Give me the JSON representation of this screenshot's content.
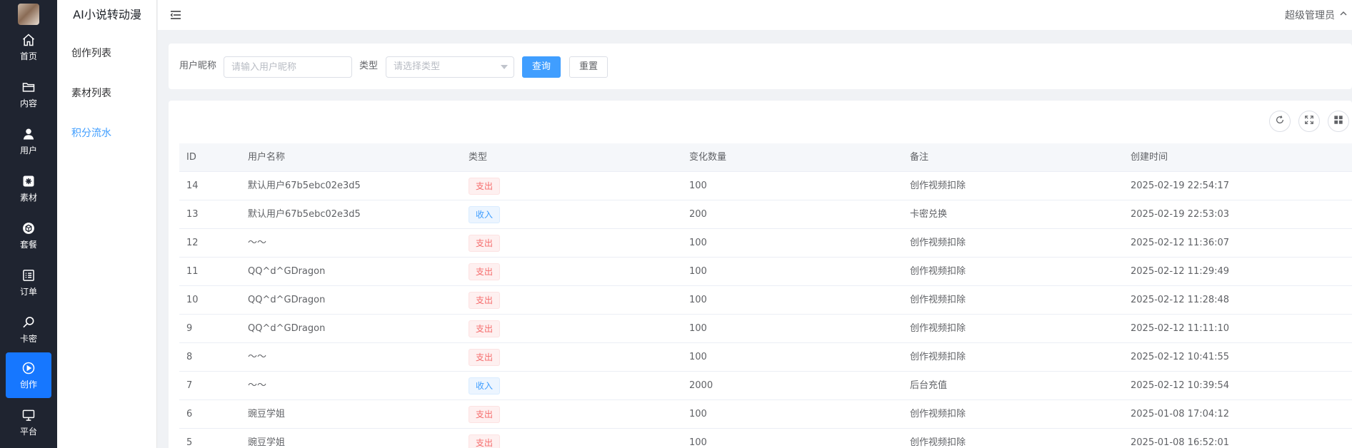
{
  "app": {
    "title": "AI小说转动漫"
  },
  "rail": {
    "items": [
      {
        "label": "首页",
        "icon": "home-icon"
      },
      {
        "label": "内容",
        "icon": "folder-icon"
      },
      {
        "label": "用户",
        "icon": "user-icon"
      },
      {
        "label": "素材",
        "icon": "material-icon"
      },
      {
        "label": "套餐",
        "icon": "package-icon"
      },
      {
        "label": "订单",
        "icon": "order-list-icon"
      },
      {
        "label": "卡密",
        "icon": "search-key-icon"
      },
      {
        "label": "创作",
        "icon": "play-circle-icon",
        "active": true
      },
      {
        "label": "平台",
        "icon": "monitor-icon"
      }
    ]
  },
  "submenu": {
    "items": [
      {
        "label": "创作列表"
      },
      {
        "label": "素材列表"
      },
      {
        "label": "积分流水",
        "active": true
      }
    ]
  },
  "header": {
    "user": "超级管理员"
  },
  "search": {
    "nickname_label": "用户昵称",
    "nickname_placeholder": "请输入用户昵称",
    "type_label": "类型",
    "type_placeholder": "请选择类型",
    "query_button": "查询",
    "reset_button": "重置"
  },
  "table": {
    "columns": [
      "ID",
      "用户名称",
      "类型",
      "变化数量",
      "备注",
      "创建时间"
    ],
    "rows": [
      {
        "id": "14",
        "name": "默认用户67b5ebc02e3d5",
        "type": "支出",
        "kind": "out",
        "amount": "100",
        "note": "创作视频扣除",
        "time": "2025-02-19 22:54:17"
      },
      {
        "id": "13",
        "name": "默认用户67b5ebc02e3d5",
        "type": "收入",
        "kind": "in",
        "amount": "200",
        "note": "卡密兑换",
        "time": "2025-02-19 22:53:03"
      },
      {
        "id": "12",
        "name": "～～",
        "type": "支出",
        "kind": "out",
        "amount": "100",
        "note": "创作视频扣除",
        "time": "2025-02-12 11:36:07"
      },
      {
        "id": "11",
        "name": "QQ^d^GDragon",
        "type": "支出",
        "kind": "out",
        "amount": "100",
        "note": "创作视频扣除",
        "time": "2025-02-12 11:29:49"
      },
      {
        "id": "10",
        "name": "QQ^d^GDragon",
        "type": "支出",
        "kind": "out",
        "amount": "100",
        "note": "创作视频扣除",
        "time": "2025-02-12 11:28:48"
      },
      {
        "id": "9",
        "name": "QQ^d^GDragon",
        "type": "支出",
        "kind": "out",
        "amount": "100",
        "note": "创作视频扣除",
        "time": "2025-02-12 11:11:10"
      },
      {
        "id": "8",
        "name": "～～",
        "type": "支出",
        "kind": "out",
        "amount": "100",
        "note": "创作视频扣除",
        "time": "2025-02-12 10:41:55"
      },
      {
        "id": "7",
        "name": "～～",
        "type": "收入",
        "kind": "in",
        "amount": "2000",
        "note": "后台充值",
        "time": "2025-02-12 10:39:54"
      },
      {
        "id": "6",
        "name": "豌豆学姐",
        "type": "支出",
        "kind": "out",
        "amount": "100",
        "note": "创作视频扣除",
        "time": "2025-01-08 17:04:12"
      },
      {
        "id": "5",
        "name": "豌豆学姐",
        "type": "支出",
        "kind": "out",
        "amount": "100",
        "note": "创作视频扣除",
        "time": "2025-01-08 16:52:01"
      }
    ]
  },
  "colors": {
    "accent": "#409eff",
    "rail_bg": "#1f2430",
    "rail_active": "#1677ff",
    "tag_out": "#f56c6c",
    "tag_in": "#409eff"
  }
}
